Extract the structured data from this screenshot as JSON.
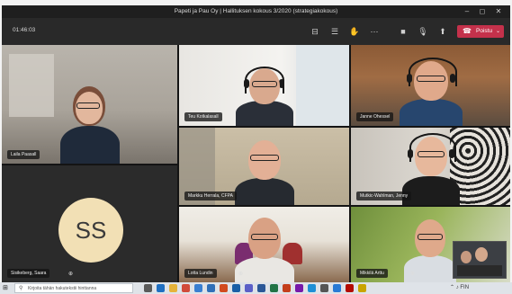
{
  "window": {
    "title": "Papeti ja Pau Oy | Hallituksen kokous 3/2020 (strategiakokous)",
    "minimize_glyph": "–",
    "maximize_glyph": "◻",
    "close_glyph": "✕"
  },
  "toolbar": {
    "timer": "01:46:03",
    "leave_label": "Poistu",
    "icons": [
      "share-tray-icon",
      "chat-icon",
      "raise-hand-icon",
      "more-options-icon",
      "camera-icon",
      "microphone-icon",
      "share-screen-icon",
      "phone-icon"
    ],
    "icon_glyphs": {
      "share_tray": "⊟",
      "chat": "☰",
      "raise_hand": "✋",
      "more": "⋯",
      "camera": "■",
      "mic": "🎙",
      "share": "⬆",
      "phone": "☎",
      "chevron": "⌄"
    }
  },
  "participants": [
    {
      "name": "Laila Paasall"
    },
    {
      "name": "Teu Kotkalasall"
    },
    {
      "name": "Janne Ohessel"
    },
    {
      "name": "Markku Herrala, CFPA"
    },
    {
      "name": "Mutkic-Wahlman, Jenny"
    },
    {
      "name": "Lotta Lundin"
    },
    {
      "name": "Mikkilä Arttu"
    },
    {
      "name": "Sisikeberg, Saara",
      "initials": "SS"
    }
  ],
  "pin_glyph": "⊕",
  "taskbar": {
    "search_placeholder": "Kirjoita tähän hakutekstii hinttanna",
    "search_glyph": "⚲",
    "start_glyph": "⊞",
    "tray_text": "⌃ ♪ FIN",
    "app_icons": [
      "task-view-icon",
      "edge-icon",
      "explorer-icon",
      "chrome-icon",
      "store-icon",
      "mail-icon",
      "office-icon",
      "outlook-icon",
      "teams-icon",
      "word-icon",
      "excel-icon",
      "powerpoint-icon",
      "onenote-icon",
      "photos-icon",
      "settings-icon",
      "calendar-icon",
      "acrobat-icon",
      "notes-icon"
    ]
  },
  "colors": {
    "accent_leave": "#c4314b",
    "avatar_bg": "#f2e0b5",
    "teams_dark": "#292929"
  }
}
